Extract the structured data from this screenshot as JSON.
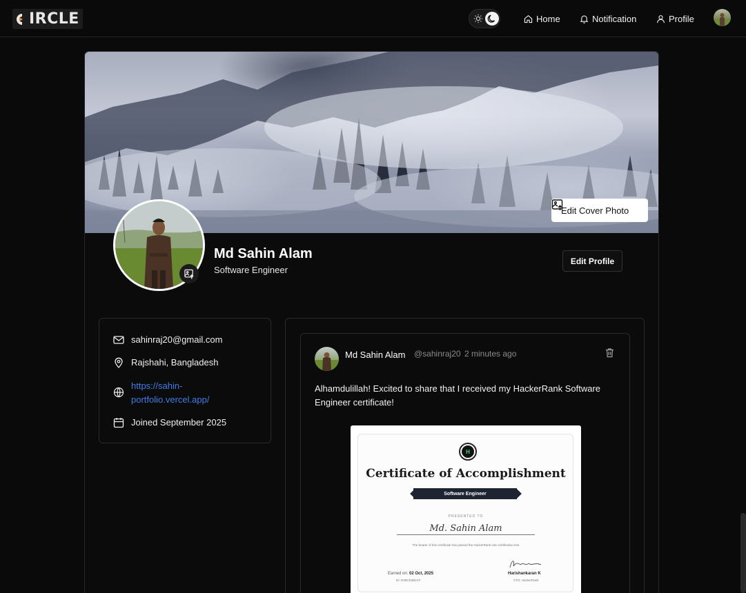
{
  "nav": {
    "logo_text": "IRCLE",
    "logo_alt": "CIRCLE",
    "links": [
      {
        "label": "Home",
        "icon": "home-icon"
      },
      {
        "label": "Notification",
        "icon": "bell-icon"
      },
      {
        "label": "Profile",
        "icon": "user-icon"
      }
    ],
    "theme": {
      "light_icon": "sun-icon",
      "dark_icon": "moon-icon",
      "active": "dark"
    }
  },
  "profile": {
    "name": "Md Sahin Alam",
    "role": "Software Engineer",
    "edit_cover_label": "Edit Cover Photo",
    "edit_profile_label": "Edit Profile"
  },
  "info": {
    "email": "sahinraj20@gmail.com",
    "location": "Rajshahi, Bangladesh",
    "website_line1": "https://sahin-",
    "website_line2": "portfolio.vercel.app/",
    "joined": "Joined September 2025"
  },
  "post": {
    "author": "Md Sahin Alam",
    "handle": "@sahinraj20",
    "time": "2 minutes ago",
    "text": "Alhamdulillah! Excited to share that I received my HackerRank Software Engineer certificate!",
    "certificate": {
      "logo": "H",
      "title": "Certificate of Accomplishment",
      "ribbon": "Software Engineer",
      "presented_to": "PRESENTED TO",
      "recipient": "Md. Sahin Alam",
      "description": "The bearer of this certificate has passed the HackerRank role certification test",
      "earned_label": "Earned on:",
      "earned_date": "02 Oct, 2025",
      "id": "ID: D38CD3B1CF",
      "signer": "Harishankaran K",
      "signer_role": "CTO, HackerRank"
    }
  },
  "colors": {
    "background": "#0a0a0a",
    "border": "#262626",
    "link": "#3f7dea",
    "muted": "#8b8b8b"
  }
}
